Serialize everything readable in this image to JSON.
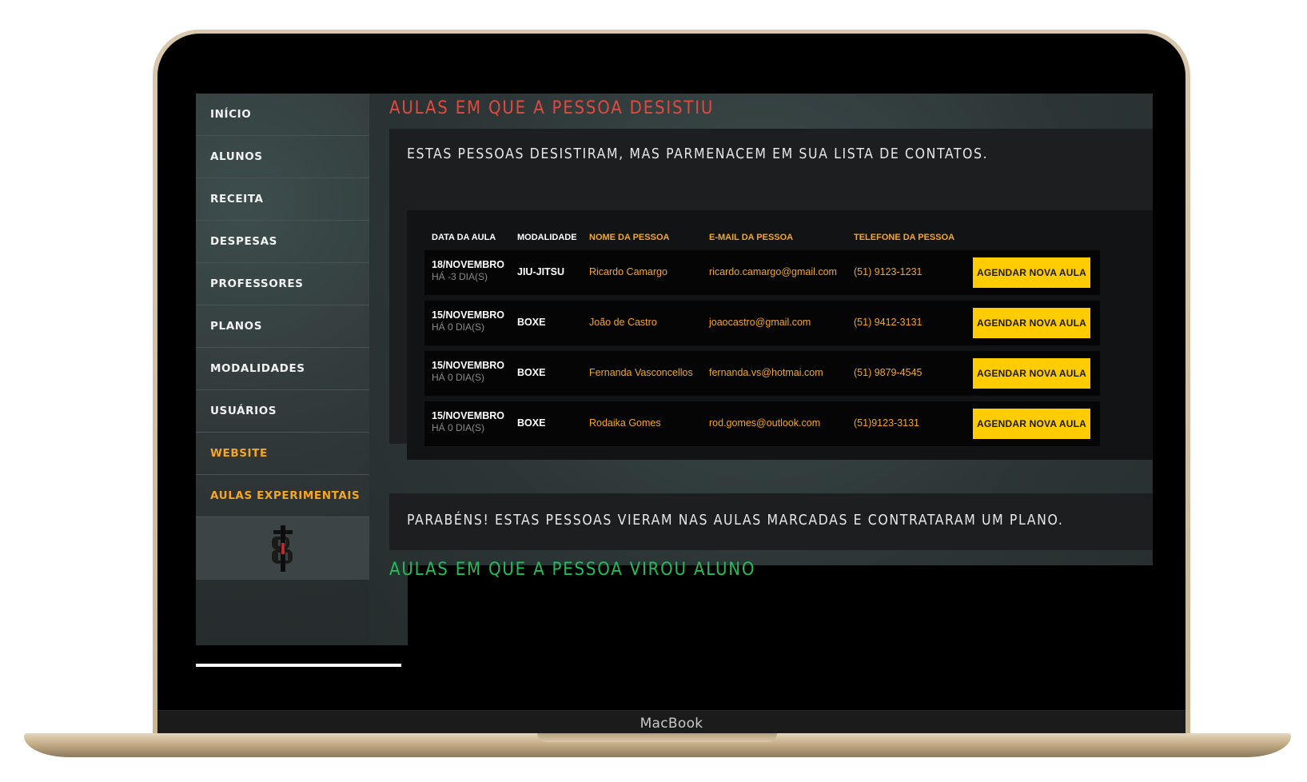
{
  "device": {
    "brand": "MacBook"
  },
  "sidebar": {
    "items": [
      {
        "label": "INÍCIO"
      },
      {
        "label": "ALUNOS"
      },
      {
        "label": "RECEITA"
      },
      {
        "label": "DESPESAS"
      },
      {
        "label": "PROFESSORES"
      },
      {
        "label": "PLANOS"
      },
      {
        "label": "MODALIDADES"
      },
      {
        "label": "USUÁRIOS"
      },
      {
        "label": "WEBSITE"
      },
      {
        "label": "AULAS EXPERIMENTAIS"
      }
    ],
    "logo_icon": "ib-logo-icon"
  },
  "section_desistiu": {
    "title": "AULAS EM QUE A PESSOA DESISTIU",
    "subtitle": "ESTAS PESSOAS DESISTIRAM, MAS PARMENACEM EM SUA LISTA DE CONTATOS.",
    "columns": {
      "date": "DATA DA AULA",
      "modality": "MODALIDADE",
      "name": "NOME DA PESSOA",
      "email": "E-MAIL DA PESSOA",
      "phone": "TELEFONE DA PESSOA"
    },
    "rows": [
      {
        "date": "18/NOVEMBRO",
        "days": "HÁ -3 DIA(S)",
        "modality": "JIU-JITSU",
        "name": "Ricardo Camargo",
        "email": "ricardo.camargo@gmail.com",
        "phone": "(51) 9123-1231",
        "action": "AGENDAR NOVA AULA"
      },
      {
        "date": "15/NOVEMBRO",
        "days": "HÁ 0 DIA(S)",
        "modality": "BOXE",
        "name": "João de Castro",
        "email": "joaocastro@gmail.com",
        "phone": "(51) 9412-3131",
        "action": "AGENDAR NOVA AULA"
      },
      {
        "date": "15/NOVEMBRO",
        "days": "HÁ 0 DIA(S)",
        "modality": "BOXE",
        "name": "Fernanda Vasconcellos",
        "email": "fernanda.vs@hotmai.com",
        "phone": "(51) 9879-4545",
        "action": "AGENDAR NOVA AULA"
      },
      {
        "date": "15/NOVEMBRO",
        "days": "HÁ 0 DIA(S)",
        "modality": "BOXE",
        "name": "Rodaika Gomes",
        "email": "rod.gomes@outlook.com",
        "phone": "(51)9123-3131",
        "action": "AGENDAR NOVA AULA"
      }
    ]
  },
  "section_aluno": {
    "title": "AULAS EM QUE A PESSOA VIROU ALUNO",
    "subtitle": "PARABÉNS! ESTAS PESSOAS VIERAM NAS AULAS MARCADAS E CONTRATARAM UM PLANO."
  },
  "colors": {
    "accent_gold": "#f5a623",
    "button_yellow": "#ffcc00",
    "title_red": "#e24a3f",
    "title_green": "#1fbf5b"
  }
}
